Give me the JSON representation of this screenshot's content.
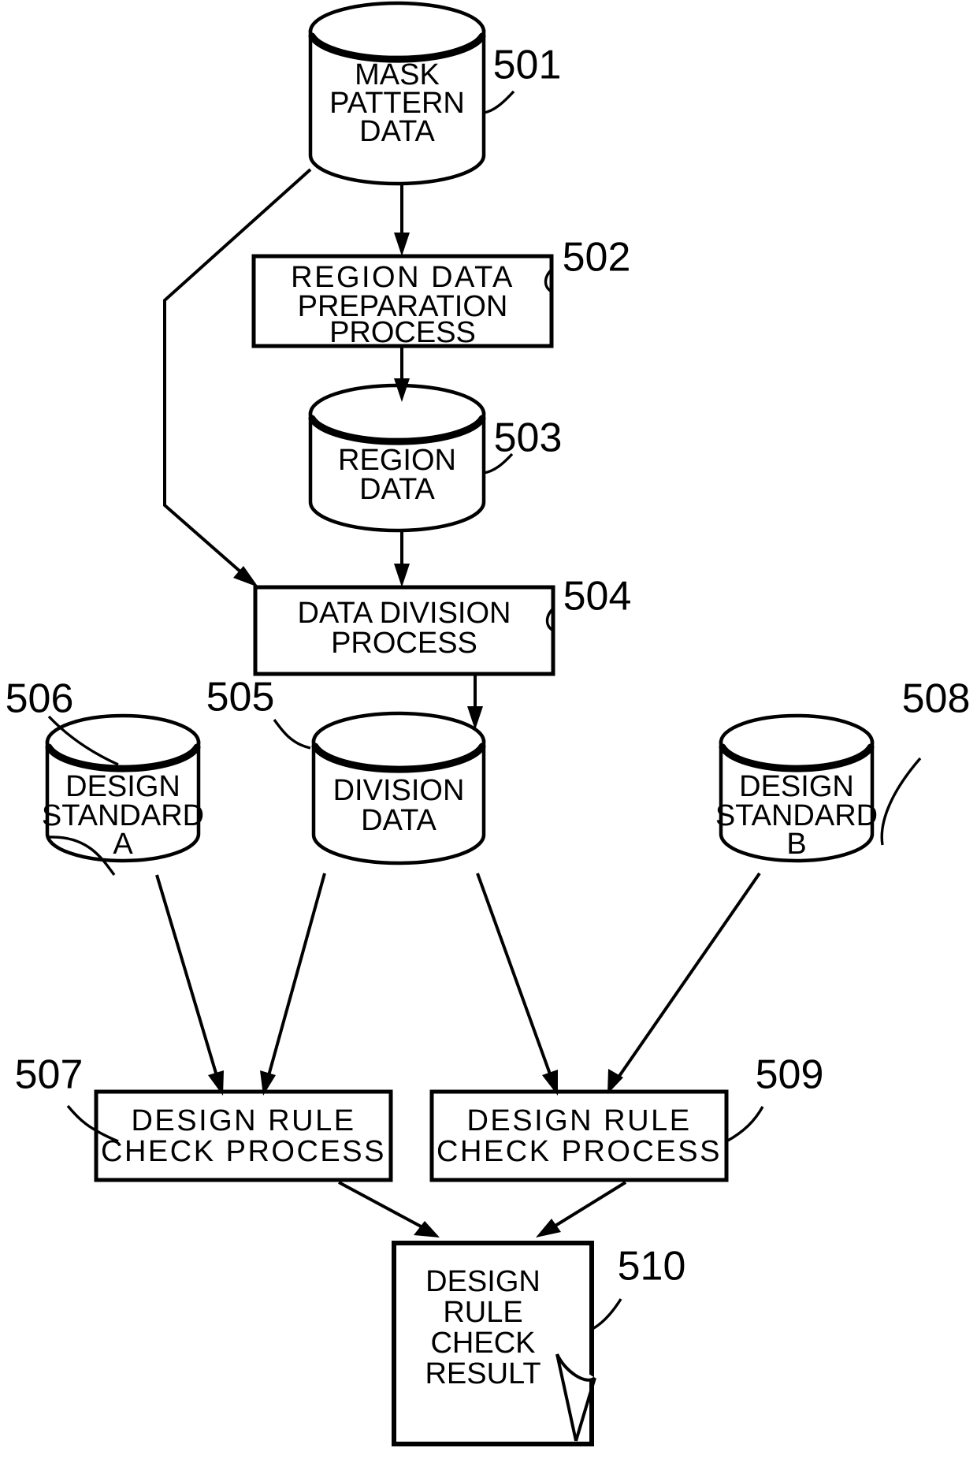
{
  "figure": {
    "title": "",
    "background_color": "#ffffff",
    "line_color": "#000000"
  },
  "nodes": [
    {
      "id": "501",
      "ref": "501",
      "type": "cylinder",
      "lines": [
        "MASK",
        "PATTERN",
        "DATA"
      ]
    },
    {
      "id": "502",
      "ref": "502",
      "type": "process",
      "lines": [
        "REGION  DATA",
        "PREPARATION",
        "PROCESS"
      ]
    },
    {
      "id": "503",
      "ref": "503",
      "type": "cylinder",
      "lines": [
        "REGION",
        "DATA"
      ]
    },
    {
      "id": "504",
      "ref": "504",
      "type": "process",
      "lines": [
        "DATA DIVISION",
        "PROCESS"
      ]
    },
    {
      "id": "505",
      "ref": "505",
      "type": "cylinder",
      "lines": [
        "DIVISION",
        "DATA"
      ]
    },
    {
      "id": "506",
      "ref": "506",
      "type": "cylinder",
      "lines": [
        "DESIGN",
        "STANDARD",
        "A"
      ]
    },
    {
      "id": "507",
      "ref": "507",
      "type": "process",
      "lines": [
        "DESIGN  RULE",
        "CHECK PROCESS"
      ]
    },
    {
      "id": "508",
      "ref": "508",
      "type": "cylinder",
      "lines": [
        "DESIGN",
        "STANDARD",
        "B"
      ]
    },
    {
      "id": "509",
      "ref": "509",
      "type": "process",
      "lines": [
        "DESIGN  RULE",
        "CHECK PROCESS"
      ]
    },
    {
      "id": "510",
      "ref": "510",
      "type": "document",
      "lines": [
        "DESIGN",
        "RULE",
        "CHECK",
        "RESULT"
      ]
    }
  ],
  "edges": [
    {
      "from": "501",
      "to": "502",
      "style": "straight-arrow"
    },
    {
      "from": "501",
      "to": "504",
      "style": "polyline-arrow"
    },
    {
      "from": "502",
      "to": "503",
      "style": "straight-arrow"
    },
    {
      "from": "503",
      "to": "504",
      "style": "straight-arrow"
    },
    {
      "from": "504",
      "to": "505",
      "style": "straight-arrow"
    },
    {
      "from": "506",
      "to": "507",
      "style": "diagonal-arrow"
    },
    {
      "from": "505",
      "to": "507",
      "style": "diagonal-arrow"
    },
    {
      "from": "505",
      "to": "509",
      "style": "diagonal-arrow"
    },
    {
      "from": "508",
      "to": "509",
      "style": "diagonal-arrow"
    },
    {
      "from": "507",
      "to": "510",
      "style": "diagonal-arrow"
    },
    {
      "from": "509",
      "to": "510",
      "style": "diagonal-arrow"
    }
  ]
}
